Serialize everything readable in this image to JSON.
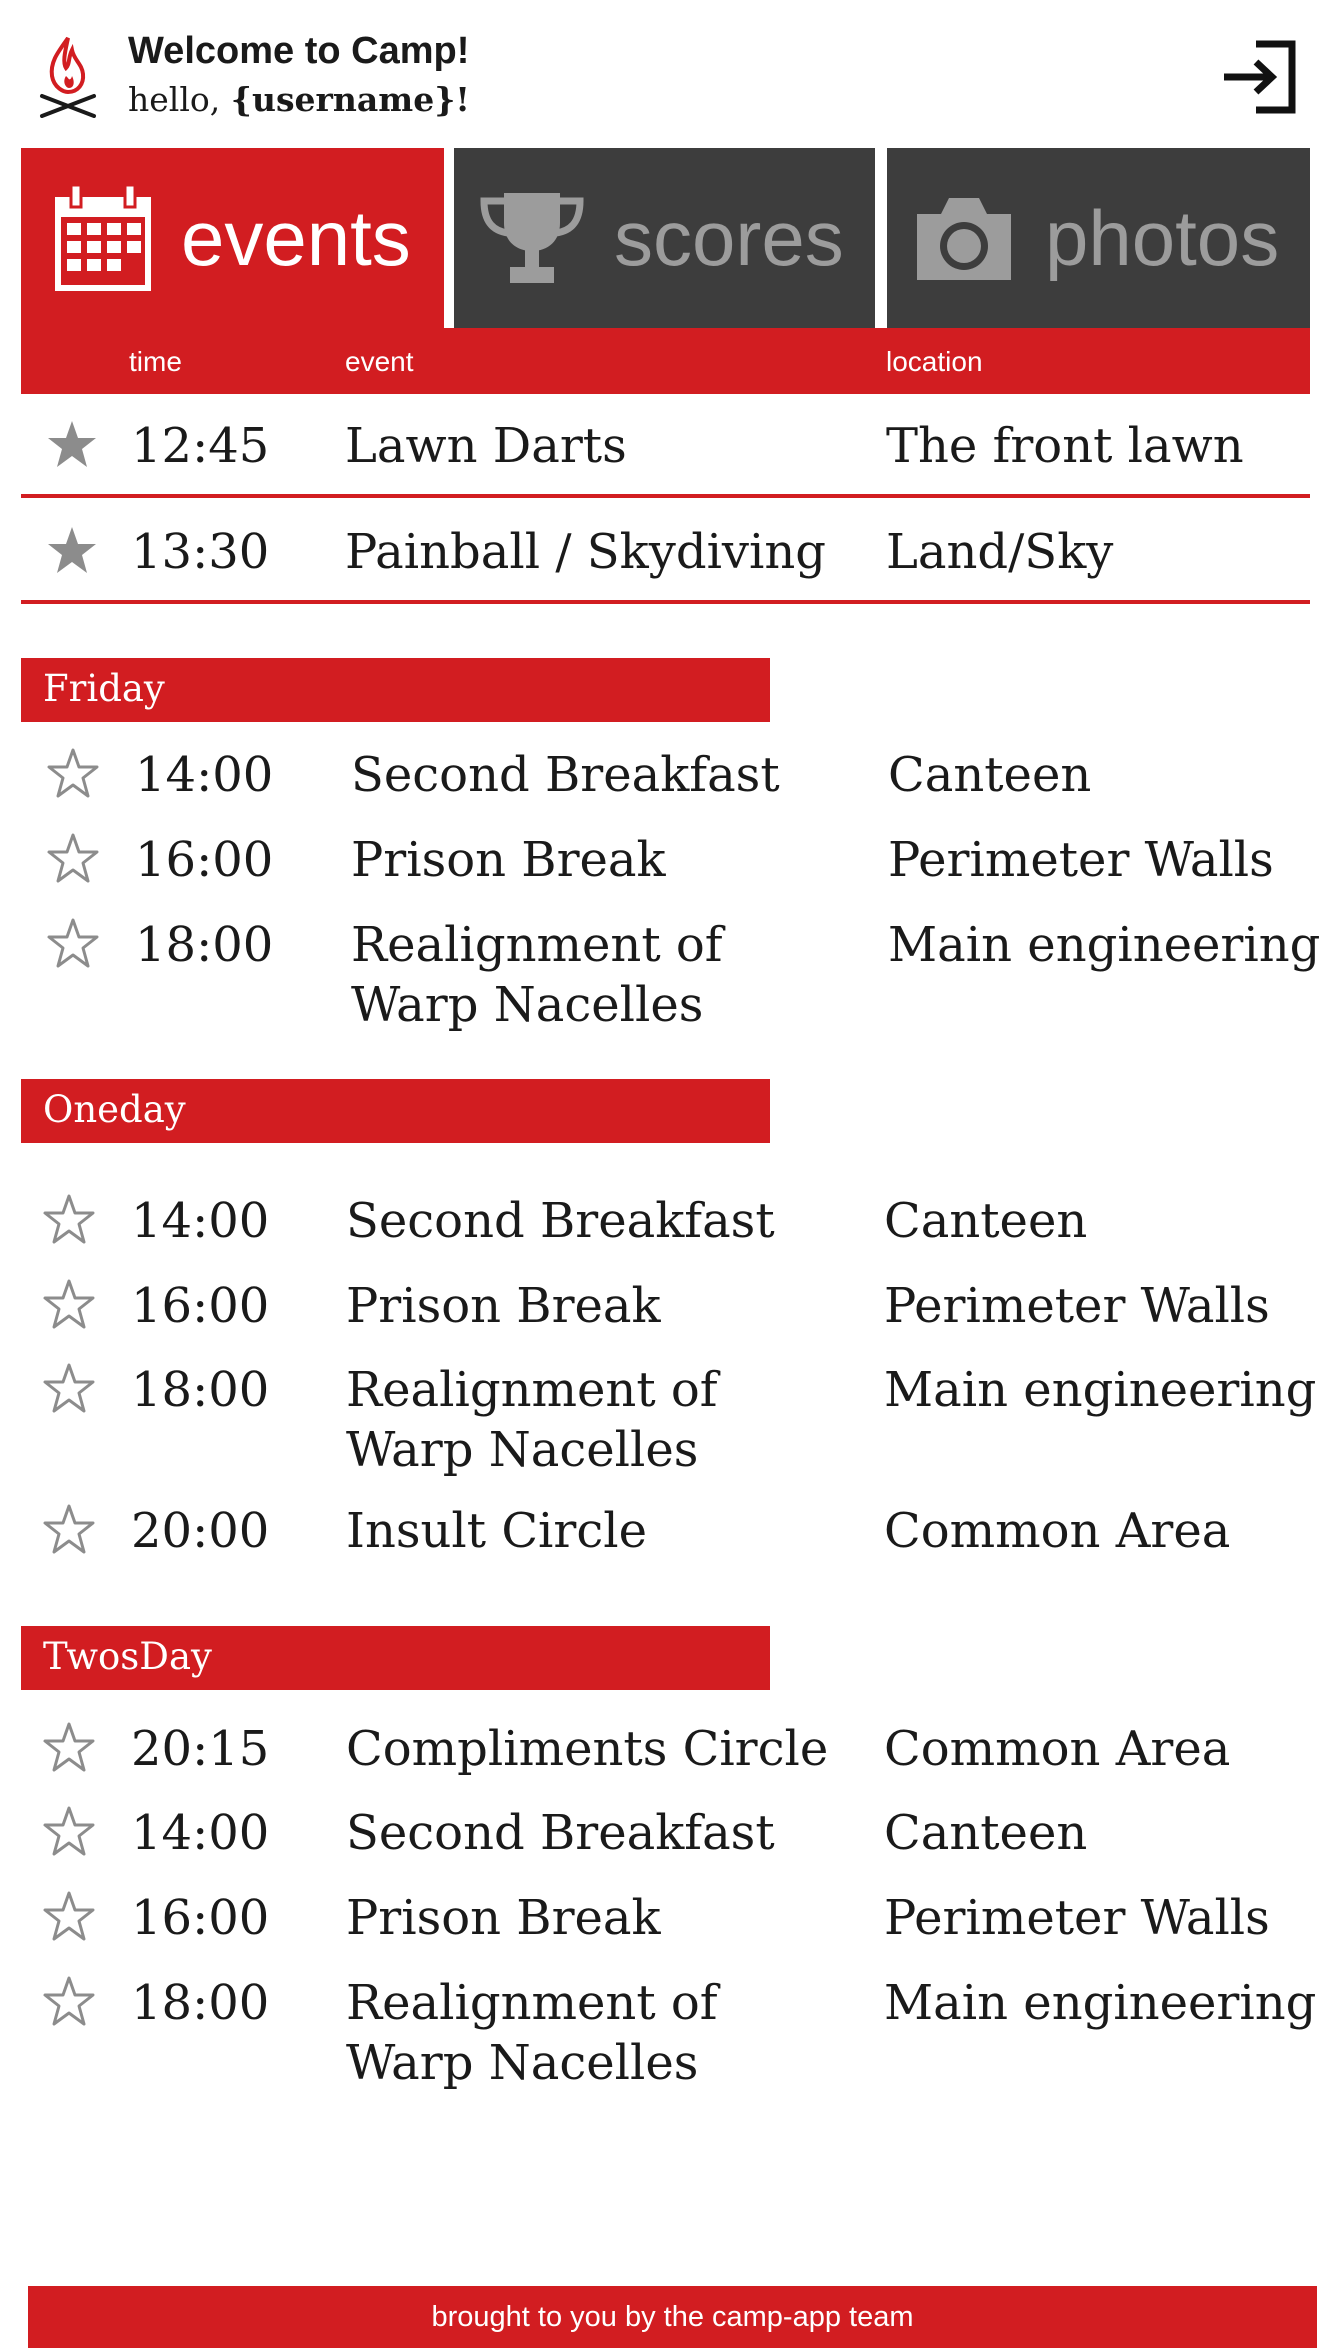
{
  "app": {
    "title": "Welcome to Camp!",
    "greeting_prefix": "hello,",
    "greeting_user": "{username}!"
  },
  "colors": {
    "accent": "#d21d21",
    "tab_inactive": "#3d3d3d",
    "tab_inactive_text": "#9c9c9c",
    "star_filled": "#8c8c8c"
  },
  "icons": {
    "logo": "campfire-icon",
    "logout": "logout-icon",
    "events": "calendar-icon",
    "scores": "trophy-icon",
    "photos": "camera-icon",
    "favorite": "star-icon"
  },
  "tabs": [
    {
      "label": "events",
      "active": true
    },
    {
      "label": "scores",
      "active": false
    },
    {
      "label": "photos",
      "active": false
    }
  ],
  "columns": {
    "time": "time",
    "event": "event",
    "location": "location"
  },
  "favorites": [
    {
      "time": "12:45",
      "event": "Lawn Darts",
      "location": "The front lawn",
      "starred": true
    },
    {
      "time": "13:30",
      "event": "Painball / Skydiving",
      "location": "Land/Sky",
      "starred": true
    }
  ],
  "days": [
    {
      "name": "Friday",
      "events": [
        {
          "time": "14:00",
          "event": "Second Breakfast",
          "location": "Canteen",
          "starred": false
        },
        {
          "time": "16:00",
          "event": "Prison Break",
          "location": "Perimeter Walls",
          "starred": false
        },
        {
          "time": "18:00",
          "event": "Realignment of\nWarp Nacelles",
          "location": "Main engineering",
          "starred": false
        }
      ]
    },
    {
      "name": "Oneday",
      "events": [
        {
          "time": "14:00",
          "event": "Second Breakfast",
          "location": "Canteen",
          "starred": false
        },
        {
          "time": "16:00",
          "event": "Prison Break",
          "location": "Perimeter Walls",
          "starred": false
        },
        {
          "time": "18:00",
          "event": "Realignment of\nWarp Nacelles",
          "location": "Main engineering",
          "starred": false
        },
        {
          "time": "20:00",
          "event": "Insult Circle",
          "location": "Common Area",
          "starred": false
        }
      ]
    },
    {
      "name": "TwosDay",
      "events": [
        {
          "time": "20:15",
          "event": "Compliments Circle",
          "location": "Common Area",
          "starred": false
        },
        {
          "time": "14:00",
          "event": "Second Breakfast",
          "location": "Canteen",
          "starred": false
        },
        {
          "time": "16:00",
          "event": "Prison Break",
          "location": "Perimeter Walls",
          "starred": false
        },
        {
          "time": "18:00",
          "event": "Realignment of\nWarp Nacelles",
          "location": "Main engineering",
          "starred": false
        }
      ]
    }
  ],
  "footer": "brought to you by the camp-app team"
}
